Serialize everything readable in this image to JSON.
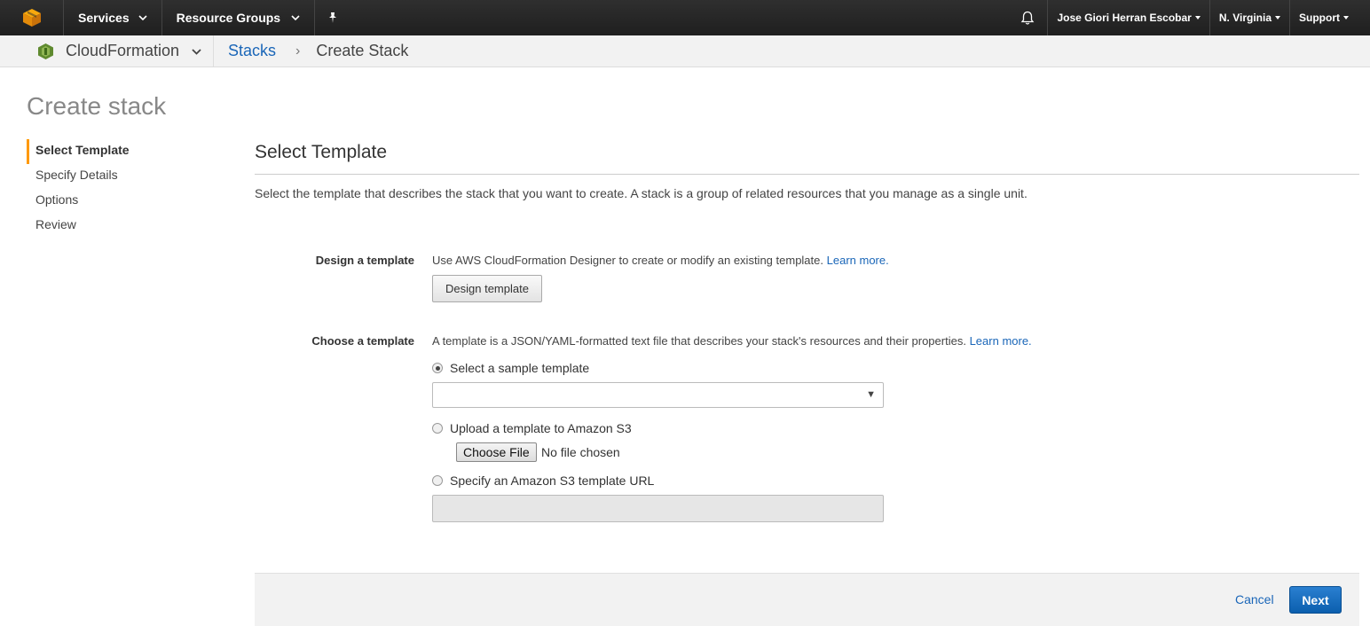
{
  "topnav": {
    "services_label": "Services",
    "resource_groups_label": "Resource Groups",
    "user_label": "Jose Giori Herran Escobar",
    "region_label": "N. Virginia",
    "support_label": "Support"
  },
  "subnav": {
    "service_label": "CloudFormation",
    "breadcrumb_stacks": "Stacks",
    "breadcrumb_sep": "›",
    "breadcrumb_current": "Create Stack"
  },
  "page": {
    "title": "Create stack"
  },
  "steps": [
    {
      "label": "Select Template",
      "active": true
    },
    {
      "label": "Specify Details",
      "active": false
    },
    {
      "label": "Options",
      "active": false
    },
    {
      "label": "Review",
      "active": false
    }
  ],
  "main": {
    "section_title": "Select Template",
    "description": "Select the template that describes the stack that you want to create. A stack is a group of related resources that you manage as a single unit.",
    "design": {
      "label": "Design a template",
      "text": "Use AWS CloudFormation Designer to create or modify an existing template.",
      "learn_more": "Learn more.",
      "button_label": "Design template"
    },
    "choose": {
      "label": "Choose a template",
      "text": "A template is a JSON/YAML-formatted text file that describes your stack's resources and their properties.",
      "learn_more": "Learn more.",
      "option_sample": "Select a sample template",
      "sample_selected_value": "",
      "option_upload": "Upload a template to Amazon S3",
      "choose_file_label": "Choose File",
      "file_status": "No file chosen",
      "option_url": "Specify an Amazon S3 template URL",
      "url_value": ""
    }
  },
  "footer": {
    "cancel_label": "Cancel",
    "next_label": "Next"
  },
  "colors": {
    "accent": "#ff9900",
    "link": "#1a66b8",
    "primary_button": "#0d6ebf"
  }
}
